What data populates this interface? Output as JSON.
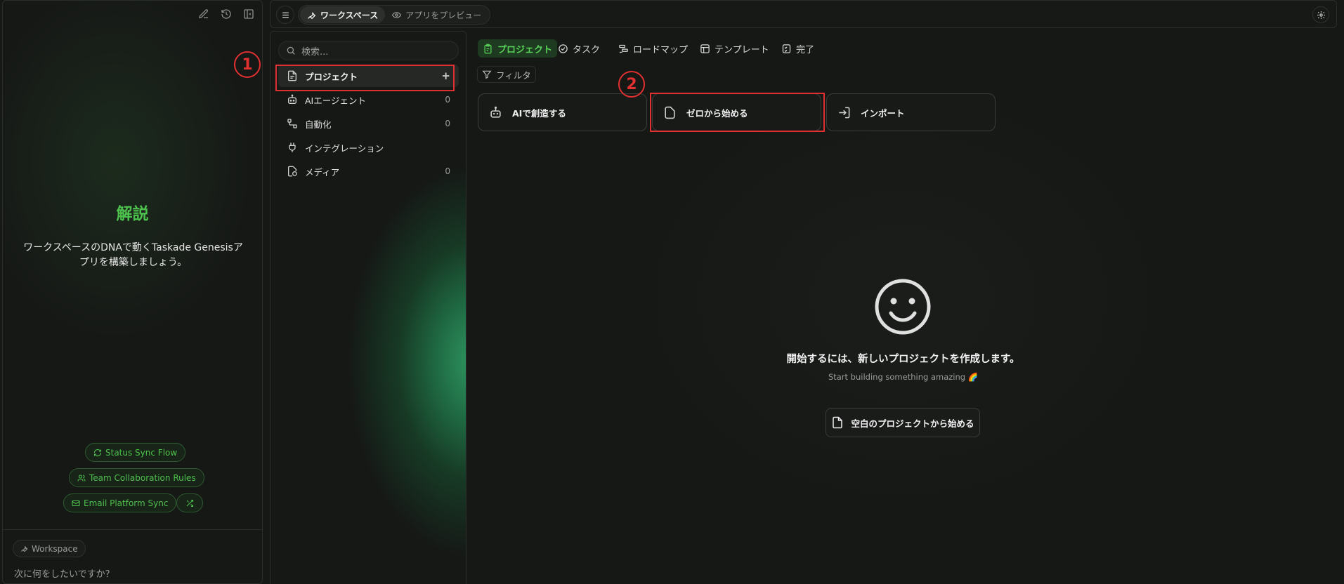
{
  "left_panel": {
    "title": "解説",
    "description": "ワークスペースのDNAで動くTaskade Genesisアプリを構築しましょう。",
    "suggestions": [
      {
        "label": "Status Sync Flow",
        "icon": "refresh-icon"
      },
      {
        "label": "Team Collaboration Rules",
        "icon": "users-icon"
      },
      {
        "label": "Email Platform Sync",
        "icon": "mail-icon"
      }
    ],
    "workspace_tag": "Workspace",
    "prompt_placeholder": "次に何をしたいですか？"
  },
  "topbar": {
    "mode_workspace": "ワークスペース",
    "mode_preview": "アプリをプレビュー"
  },
  "nav": {
    "search_placeholder": "検索...",
    "items": [
      {
        "label": "プロジェクト",
        "count": "+",
        "icon": "document-icon"
      },
      {
        "label": "AIエージェント",
        "count": "0",
        "icon": "robot-icon"
      },
      {
        "label": "自動化",
        "count": "0",
        "icon": "flow-icon"
      },
      {
        "label": "インテグレーション",
        "count": "",
        "icon": "plug-icon"
      },
      {
        "label": "メディア",
        "count": "0",
        "icon": "media-icon"
      }
    ]
  },
  "main": {
    "tabs": [
      {
        "label": "プロジェクト",
        "icon": "clipboard-icon"
      },
      {
        "label": "タスク",
        "icon": "check-circle-icon"
      },
      {
        "label": "ロードマップ",
        "icon": "roadmap-icon"
      },
      {
        "label": "テンプレート",
        "icon": "template-icon"
      },
      {
        "label": "完了",
        "icon": "done-icon"
      }
    ],
    "filter_label": "フィルタ",
    "actions": [
      {
        "label": "AIで創造する",
        "icon": "robot-icon"
      },
      {
        "label": "ゼロから始める",
        "icon": "blank-page-icon"
      },
      {
        "label": "インポート",
        "icon": "import-icon"
      }
    ],
    "empty_title": "開始するには、新しいプロジェクトを作成します。",
    "empty_subtitle": "Start building something amazing 🌈",
    "blank_button": "空白のプロジェクトから始める"
  },
  "annotations": {
    "step1": "1",
    "step2": "2"
  },
  "colors": {
    "accent": "#4ec24e",
    "highlight": "#e03030",
    "background": "#161816"
  }
}
